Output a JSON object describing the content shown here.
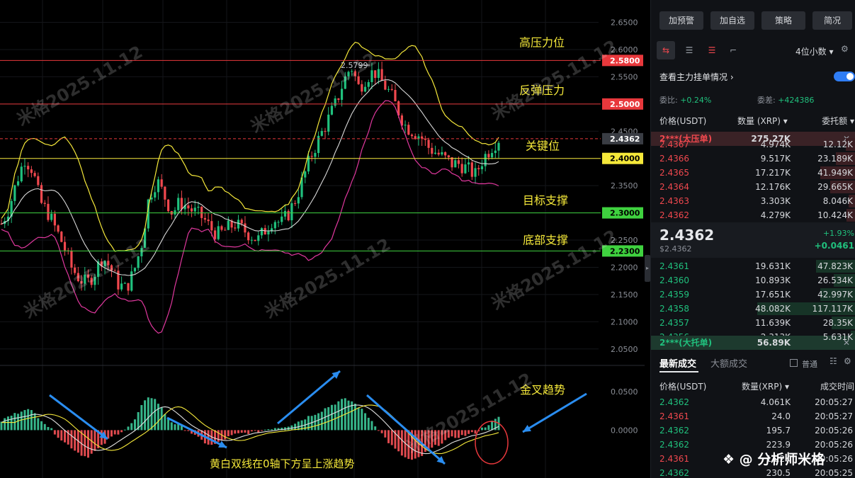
{
  "chart_data": {
    "type": "candlestick",
    "price_axis": {
      "ticks": [
        "2.6500",
        "2.6000",
        "2.5500",
        "2.5000",
        "2.4500",
        "2.4000",
        "2.3500",
        "2.3000",
        "2.2500",
        "2.2000",
        "2.1500",
        "2.1000",
        "2.0500"
      ],
      "ylim": [
        2.025,
        2.665
      ]
    },
    "macd_axis": {
      "ticks": [
        "0.0500",
        "0.0000"
      ],
      "ylim": [
        -0.062,
        0.082
      ]
    },
    "peak_label": "2.5799",
    "levels": [
      {
        "value": 2.58,
        "label": "2.5800",
        "color": "#e8383c",
        "tag_bg": "#e8383c",
        "name": "高压力位"
      },
      {
        "value": 2.5,
        "label": "2.5000",
        "color": "#e8383c",
        "tag_bg": "#e8383c",
        "name": "反弹压力"
      },
      {
        "value": 2.4362,
        "label": "2.4362",
        "color": "#e8383c",
        "tag_bg": "#3a3d44",
        "name": "",
        "dashed": true
      },
      {
        "value": 2.4,
        "label": "2.4000",
        "color": "#f5e83a",
        "tag_bg": "#f5e83a",
        "name": "关键位"
      },
      {
        "value": 2.3,
        "label": "2.3000",
        "color": "#3fd23f",
        "tag_bg": "#3fd23f",
        "name": "目标支撑"
      },
      {
        "value": 2.23,
        "label": "2.2300",
        "color": "#3fd23f",
        "tag_bg": "#3fd23f",
        "name": "底部支撑"
      }
    ],
    "annotations": {
      "golden_cross": "金叉趋势",
      "macd_note": "黄白双线在0轴下方呈上涨趋势"
    },
    "watermark": "米格2025.11.12",
    "close_path": [
      2.28,
      2.31,
      2.36,
      2.4,
      2.38,
      2.32,
      2.3,
      2.27,
      2.24,
      2.2,
      2.18,
      2.17,
      2.19,
      2.22,
      2.2,
      2.17,
      2.16,
      2.19,
      2.24,
      2.33,
      2.36,
      2.33,
      2.3,
      2.32,
      2.31,
      2.3,
      2.29,
      2.27,
      2.26,
      2.27,
      2.28,
      2.27,
      2.26,
      2.25,
      2.27,
      2.29,
      2.28,
      2.3,
      2.33,
      2.37,
      2.41,
      2.44,
      2.47,
      2.5,
      2.54,
      2.57,
      2.53,
      2.55,
      2.56,
      2.54,
      2.52,
      2.49,
      2.46,
      2.45,
      2.44,
      2.42,
      2.41,
      2.4,
      2.39,
      2.39,
      2.38,
      2.37,
      2.4,
      2.42,
      2.4362
    ],
    "macd_hist": [
      0.012,
      0.018,
      0.022,
      0.028,
      0.024,
      0.015,
      0.005,
      -0.005,
      -0.015,
      -0.022,
      -0.03,
      -0.035,
      -0.028,
      -0.02,
      -0.01,
      -0.004,
      0.002,
      0.01,
      0.03,
      0.045,
      0.038,
      0.022,
      0.01,
      0.005,
      0.0,
      -0.008,
      -0.015,
      -0.02,
      -0.016,
      -0.01,
      -0.006,
      -0.004,
      -0.003,
      -0.002,
      0.001,
      0.003,
      0.004,
      0.006,
      0.01,
      0.015,
      0.02,
      0.024,
      0.03,
      0.035,
      0.04,
      0.038,
      0.03,
      0.02,
      0.008,
      -0.005,
      -0.018,
      -0.028,
      -0.036,
      -0.04,
      -0.034,
      -0.026,
      -0.02,
      -0.014,
      -0.01,
      -0.008,
      -0.006,
      -0.003,
      0.003,
      0.01,
      0.016
    ]
  },
  "panel": {
    "buttons": [
      "加预警",
      "加自选",
      "策略",
      "简况"
    ],
    "decimals": "4位小数",
    "order_book_toggle": "查看主力挂单情况",
    "ratio_label": "委比:",
    "ratio_value": "+0.24%",
    "diff_label": "委差:",
    "diff_value": "+424386",
    "col_price": "价格(USDT)",
    "col_qty": "数量 (XRP)",
    "col_amount": "委托额",
    "big_ask": {
      "name": "2***(大压单)",
      "qty": "275.27K"
    },
    "asks": [
      {
        "price": "2.4367",
        "qty": "4.974K",
        "amount": "12.12K",
        "bar": 0.1
      },
      {
        "price": "2.4366",
        "qty": "9.517K",
        "amount": "23.189K",
        "bar": 0.2
      },
      {
        "price": "2.4365",
        "qty": "17.217K",
        "amount": "41.949K",
        "bar": 0.36
      },
      {
        "price": "2.4364",
        "qty": "12.176K",
        "amount": "29.665K",
        "bar": 0.26
      },
      {
        "price": "2.4363",
        "qty": "3.303K",
        "amount": "8.046K",
        "bar": 0.07
      },
      {
        "price": "2.4362",
        "qty": "4.279K",
        "amount": "10.424K",
        "bar": 0.09
      }
    ],
    "last_price": "2.4362",
    "last_usd": "$2.4362",
    "change_pct": "+1.93%",
    "change_abs": "+0.0461",
    "bids": [
      {
        "price": "2.4361",
        "qty": "19.631K",
        "amount": "47.823K",
        "bar": 0.4
      },
      {
        "price": "2.4360",
        "qty": "10.893K",
        "amount": "26.534K",
        "bar": 0.22
      },
      {
        "price": "2.4359",
        "qty": "17.651K",
        "amount": "42.997K",
        "bar": 0.36
      },
      {
        "price": "2.4358",
        "qty": "48.082K",
        "amount": "117.117K",
        "bar": 0.99
      },
      {
        "price": "2.4357",
        "qty": "11.639K",
        "amount": "28.35K",
        "bar": 0.24
      },
      {
        "price": "2.4356",
        "qty": "2.313K",
        "amount": "5.631K",
        "bar": 0.05
      }
    ],
    "big_bid": {
      "name": "2***(大托单)",
      "qty": "56.89K"
    },
    "tab_latest": "最新成交",
    "tab_large": "大额成交",
    "normal_label": "普通",
    "trade_col_price": "价格(USDT)",
    "trade_col_qty": "数量(XRP)",
    "trade_col_time": "成交时间",
    "trades": [
      {
        "price": "2.4362",
        "qty": "4.061K",
        "time": "20:05:27",
        "side": "buy"
      },
      {
        "price": "2.4361",
        "qty": "24.0",
        "time": "20:05:27",
        "side": "sell"
      },
      {
        "price": "2.4362",
        "qty": "195.7",
        "time": "20:05:26",
        "side": "buy"
      },
      {
        "price": "2.4362",
        "qty": "223.9",
        "time": "20:05:26",
        "side": "buy"
      },
      {
        "price": "2.4361",
        "qty": "1.22K",
        "time": "20:05:26",
        "side": "sell"
      },
      {
        "price": "2.4362",
        "qty": "230.5",
        "time": "20:05:25",
        "side": "buy"
      }
    ],
    "author_badge": "分析师米格"
  },
  "colors": {
    "up": "#20c07d",
    "down": "#f0484e",
    "yellow": "#f5e83a",
    "white": "#d9d9d9",
    "magenta": "#e0389e",
    "arrow": "#2a8df0"
  }
}
